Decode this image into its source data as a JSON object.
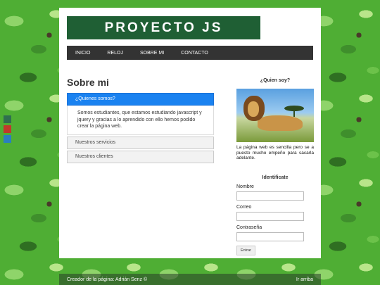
{
  "header": {
    "logo_text": "PROYECTO JS"
  },
  "nav": {
    "items": [
      "INICIO",
      "RELOJ",
      "SOBRE MI",
      "CONTACTO"
    ]
  },
  "main": {
    "title": "Sobre mi",
    "accordion": [
      {
        "label": "¿Quienes somos?",
        "active": true,
        "body": "Somos estudiantes, que estamos estudiando javascript y jquery y gracias a lo aprendido con ello hemos podido crear la página web."
      },
      {
        "label": "Nuestros servicios",
        "active": false
      },
      {
        "label": "Nuestros clientes",
        "active": false
      }
    ]
  },
  "sidebar": {
    "about_title": "¿Quien soy?",
    "about_text": "La página web es sencilla pero se a puesto mucho empeño para sacarla adelante.",
    "login": {
      "title": "Identificate",
      "fields": [
        {
          "label": "Nombre",
          "value": ""
        },
        {
          "label": "Correo",
          "value": ""
        },
        {
          "label": "Contraseña",
          "value": ""
        }
      ],
      "submit_label": "Entrar"
    }
  },
  "theme_swatches": [
    "#2f6f4f",
    "#c0392b",
    "#2a7fbf"
  ],
  "colors": {
    "nav_bg": "#333333",
    "logo_bg": "#1f5f34",
    "accordion_active": "#1a82f0"
  },
  "footer": {
    "credit": "Creador de la página: Adrián Senz ©",
    "back_to_top": "Ir arriba"
  }
}
